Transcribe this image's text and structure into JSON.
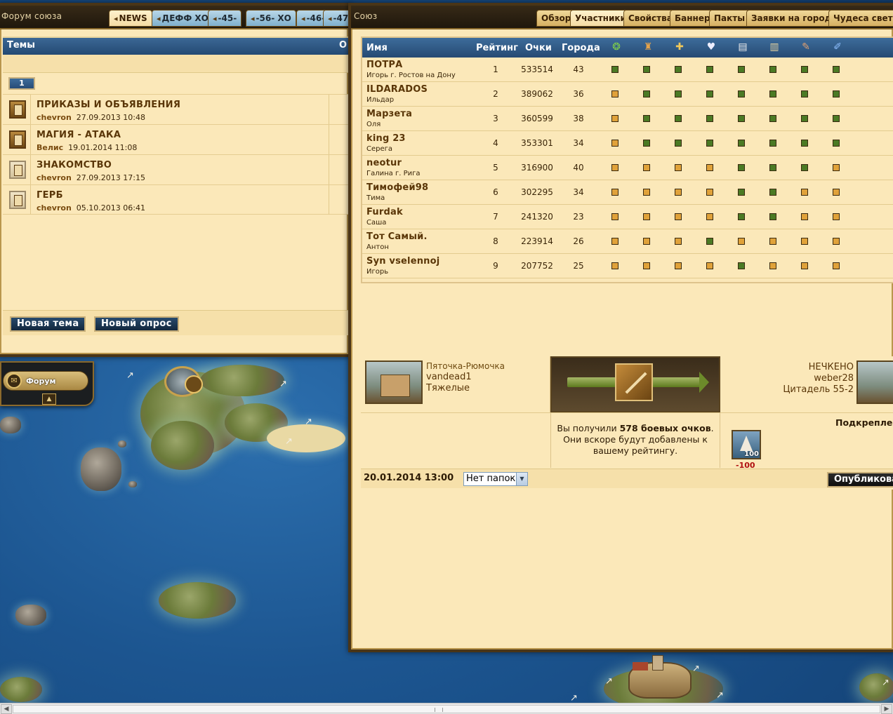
{
  "map": {
    "forum_label": "Форум"
  },
  "forum": {
    "title": "Форум союза",
    "tabs": [
      "NEWS",
      "ДЕФФ ХО",
      "-45-",
      "-56- ХО",
      "-46-",
      "-47"
    ],
    "header": "Темы",
    "header_right": "О",
    "page": "1",
    "topics": [
      {
        "name": "ПРИКАЗЫ И ОБЪЯВЛЕНИЯ",
        "author": "chevron",
        "date": "27.09.2013 10:48",
        "icon": "book-icon"
      },
      {
        "name": "МАГИЯ - АТАКА",
        "author": "Велис",
        "date": "19.01.2014 11:08",
        "icon": "book-icon"
      },
      {
        "name": "ЗНАКОМСТВО",
        "author": "chevron",
        "date": "27.09.2013 17:15",
        "icon": "scroll-icon"
      },
      {
        "name": "ГЕРБ",
        "author": "chevron",
        "date": "05.10.2013 06:41",
        "icon": "scroll-icon"
      }
    ],
    "new_topic": "Новая тема",
    "new_poll": "Новый опрос"
  },
  "alliance": {
    "title": "Союз",
    "tabs": [
      "Обзор",
      "Участники",
      "Свойства",
      "Баннер",
      "Пакты",
      "Заявки на города",
      "Чудеса света"
    ],
    "active_tab": "Участники",
    "columns": {
      "name": "Имя",
      "rank": "Рейтинг",
      "points": "Очки",
      "cities": "Города"
    },
    "perm_icons": [
      "laurel-icon",
      "helmet-icon",
      "plus-icon",
      "dove-icon",
      "map-icon",
      "scroll-icon",
      "quill-icon",
      "brush-icon"
    ],
    "members": [
      {
        "name": "ПОТРА",
        "sub": "Игорь г. Ростов на Дону",
        "rank": "1",
        "points": "533514",
        "cities": "43",
        "perms": "gggggggg"
      },
      {
        "name": "ILDARADOS",
        "sub": "Ильдар",
        "rank": "2",
        "points": "389062",
        "cities": "36",
        "perms": "oggggggg"
      },
      {
        "name": "Марзета",
        "sub": "Оля",
        "rank": "3",
        "points": "360599",
        "cities": "38",
        "perms": "oggggggg"
      },
      {
        "name": "king 23",
        "sub": "Серега",
        "rank": "4",
        "points": "353301",
        "cities": "34",
        "perms": "oggggggg"
      },
      {
        "name": "neotur",
        "sub": "Галина г. Рига",
        "rank": "5",
        "points": "316900",
        "cities": "40",
        "perms": "oooogggo"
      },
      {
        "name": "Тимофей98",
        "sub": "Тима",
        "rank": "6",
        "points": "302295",
        "cities": "34",
        "perms": "ooooggoo"
      },
      {
        "name": "Furdak",
        "sub": "Саша",
        "rank": "7",
        "points": "241320",
        "cities": "23",
        "perms": "ooooggoo"
      },
      {
        "name": "Тот Самый.",
        "sub": "Антон",
        "rank": "8",
        "points": "223914",
        "cities": "26",
        "perms": "ooogoooo"
      },
      {
        "name": "Syn vselennoj",
        "sub": "Игорь",
        "rank": "9",
        "points": "207752",
        "cities": "25",
        "perms": "oooogooo"
      }
    ],
    "colors": {
      "green": "#4b7a24",
      "orange": "#e0a23a"
    }
  },
  "report": {
    "left_city": "Пяточка-Рюмочка",
    "left_player": "vandead1",
    "left_unit": "Тяжелые",
    "right_city": "НЕЧКЕНО",
    "right_player": "weber28",
    "right_place": "Цитадель 55-2",
    "msg_pre": "Вы получили ",
    "msg_bold": "578 боевых очков",
    "msg_post": ". Они вскоре будут добавлены к вашему рейтингу.",
    "reinforce": "Подкреплен",
    "ship_count": "100",
    "ship_loss": "-100",
    "date": "20.01.2014 13:00",
    "folder": "Нет папок",
    "publish": "Опубликова"
  }
}
